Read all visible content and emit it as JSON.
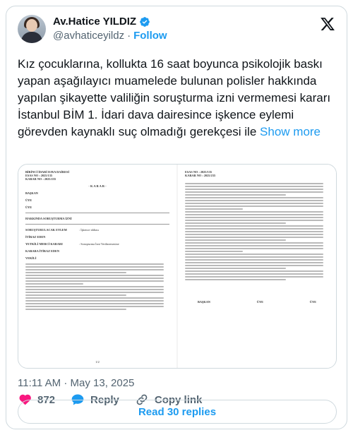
{
  "author": {
    "name": "Av.Hatice YILDIZ",
    "handle": "@avhaticeyildz",
    "follow_label": "Follow",
    "separator": "·"
  },
  "icons": {
    "verified": "verified-badge-icon",
    "brand": "x-logo-icon",
    "like": "heart-icon",
    "reply": "speech-bubble-icon",
    "copy": "link-icon"
  },
  "colors": {
    "accent": "#1d9bf0",
    "like": "#f91880",
    "text": "#0f1419",
    "muted": "#536471"
  },
  "tweet": {
    "text": "Kız çocuklarına, kollukta 16 saat boyunca psikolojik baskı yapan aşağılayıcı muamelede bulunan polisler hakkında yapılan şikayette valiliğin soruşturma izni vermemesi kararı İstanbul BİM 1. İdari dava dairesince işkence eylemi görevden kaynaklı suç olmadığı gerekçesi ile",
    "show_more": "Show more"
  },
  "document": {
    "left": {
      "court": "BİRİNCİ İDARİ DAVA DAİRESİ",
      "esas": "ESAS NO : 2025/135",
      "karar_no": "KARAR NO : 2025/235",
      "karar_heading": "- K A R A R -",
      "fields": [
        {
          "label": "BAŞKAN",
          "value": ""
        },
        {
          "label": "ÜYE",
          "value": ""
        },
        {
          "label": "ÜYE",
          "value": ""
        },
        {
          "label": "HAKKINDA SORUŞTURMA İZNİ",
          "value": ""
        },
        {
          "label": "SORUŞTURULACAK EYLEM",
          "value": ": İşkence iddiası"
        },
        {
          "label": "İTİRAZ EDEN",
          "value": ""
        },
        {
          "label": "YETKİLİ MERCİ KARARI",
          "value": ": Soruşturma İzni Verilmemesine"
        },
        {
          "label": "KARARA İTİRAZ EDEN",
          "value": ""
        },
        {
          "label": "VEKİLİ",
          "value": ""
        }
      ],
      "page_number": "1/2"
    },
    "right": {
      "esas": "ESAS NO : 2025/135",
      "karar_no": "KARAR NO : 2025/235",
      "signatures": [
        "BAŞKAN",
        "ÜYE",
        "ÜYE"
      ]
    }
  },
  "meta": {
    "time": "11:11 AM",
    "separator": "·",
    "date": "May 13, 2025"
  },
  "actions": {
    "like_count": "872",
    "reply_label": "Reply",
    "copy_label": "Copy link"
  },
  "replies": {
    "label": "Read 30 replies"
  }
}
